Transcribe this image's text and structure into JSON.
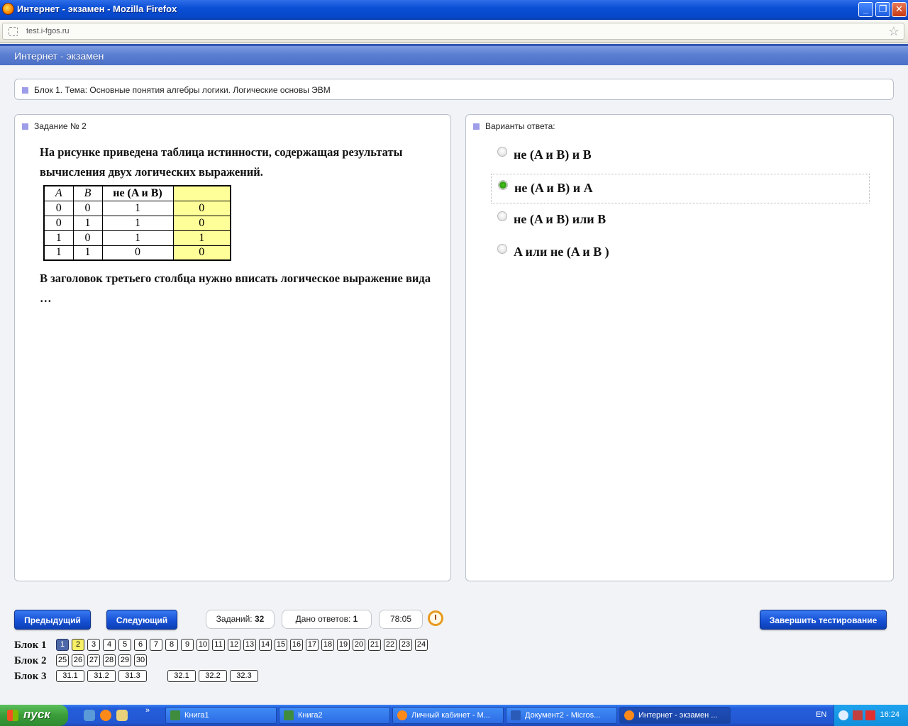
{
  "window": {
    "title": "Интернет - экзамен - Mozilla Firefox",
    "minimize": "_",
    "restore": "❐",
    "close": "✕"
  },
  "browser": {
    "url": "test.i-fgos.ru"
  },
  "app": {
    "title": "Интернет - экзамен"
  },
  "topic": "Блок 1. Тема: Основные понятия алгебры логики. Логические основы ЭВМ",
  "task": {
    "heading": "Задание № 2",
    "text_before": "На рисунке приведена таблица истинности, содержащая результаты вычисления двух логических выражений.",
    "text_after": "В заголовок  третьего столбца нужно вписать логическое выражение вида …",
    "table": {
      "headers": [
        "A",
        "B",
        "не (A и B)",
        ""
      ],
      "rows": [
        [
          "0",
          "0",
          "1",
          "0"
        ],
        [
          "0",
          "1",
          "1",
          "0"
        ],
        [
          "1",
          "0",
          "1",
          "1"
        ],
        [
          "1",
          "1",
          "0",
          "0"
        ]
      ]
    }
  },
  "answers": {
    "heading": "Варианты ответа:",
    "options": [
      {
        "label": "не (A  и B) и B",
        "selected": false
      },
      {
        "label": "не (A и B) и A",
        "selected": true
      },
      {
        "label": "не (A  и B) или B",
        "selected": false
      },
      {
        "label": "A или  не (A и B )",
        "selected": false
      }
    ]
  },
  "controls": {
    "prev": "Предыдущий",
    "next": "Следующий",
    "tasks_label": "Заданий:",
    "tasks_count": "32",
    "answered_label": "Дано ответов:",
    "answered_count": "1",
    "timer": "78:05",
    "finish": "Завершить тестирование"
  },
  "blocks": [
    {
      "label": "Блок 1",
      "items": [
        "1",
        "2",
        "3",
        "4",
        "5",
        "6",
        "7",
        "8",
        "9",
        "10",
        "11",
        "12",
        "13",
        "14",
        "15",
        "16",
        "17",
        "18",
        "19",
        "20",
        "21",
        "22",
        "23",
        "24"
      ]
    },
    {
      "label": "Блок 2",
      "items": [
        "25",
        "26",
        "27",
        "28",
        "29",
        "30"
      ]
    },
    {
      "label": "Блок 3",
      "items": [
        "31.1",
        "31.2",
        "31.3",
        "32.1",
        "32.2",
        "32.3"
      ]
    }
  ],
  "taskbar": {
    "start": "пуск",
    "items": [
      "Книга1",
      "Книга2",
      "Личный кабинет - М...",
      "Документ2 - Micros...",
      "Интернет - экзамен ..."
    ],
    "lang": "EN",
    "time": "16:24"
  }
}
